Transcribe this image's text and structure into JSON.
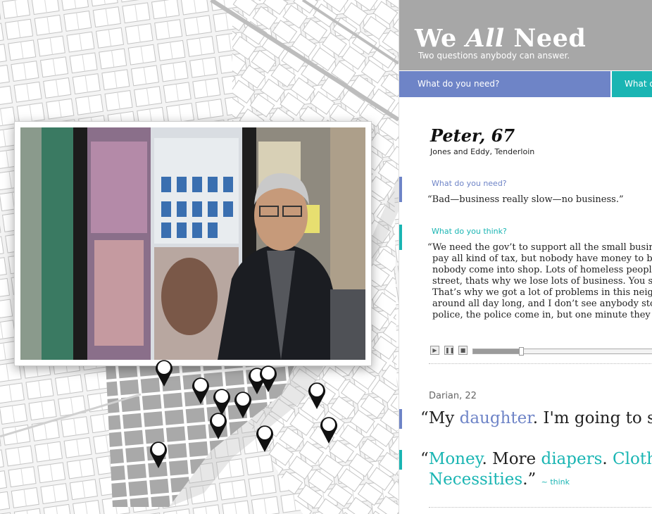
{
  "header": {
    "title_we": "We",
    "title_all": "All",
    "title_need": "Need",
    "subtitle": "Two questions anybody can answer."
  },
  "tabs": [
    {
      "label": "What do you need?"
    },
    {
      "label": "What d"
    }
  ],
  "featured": {
    "name": "Peter, 67",
    "location": "Jones and Eddy, Tenderloin",
    "need_label": "What do you need?",
    "need_answer": "“Bad—business really slow—no business.”",
    "think_label": "What do you think?",
    "think_lines": [
      "“We need the gov’t to support all the small busin",
      "pay all kind of tax, but nobody have money to b",
      "nobody come into shop. Lots of homeless peopl",
      "street, thats why we lose lots of business. You s",
      "That’s why we got a lot of problems in this neig",
      "around all day long, and I don’t see anybody sto",
      "police, the police come in, but one minute they"
    ],
    "audio_progress": 0.25
  },
  "second": {
    "name": "Darian, 22",
    "need_open": "“My ",
    "need_hl": "daughter",
    "need_rest": ". I'm going to se",
    "think_open": "“",
    "think_hl1": "Money",
    "think_mid1": ". More ",
    "think_hl2": "diapers",
    "think_mid2": ". ",
    "think_hl3": "Clothe",
    "think_hl4": "Necessities",
    "think_close": ".”",
    "think_link": "~ think"
  },
  "icons": {
    "play": "play-icon",
    "pause": "pause-icon",
    "stop": "stop-icon",
    "pin": "map-pin-icon"
  },
  "colors": {
    "need": "#6e84c7",
    "think": "#1ab5b3",
    "header": "#a7a7a7"
  }
}
